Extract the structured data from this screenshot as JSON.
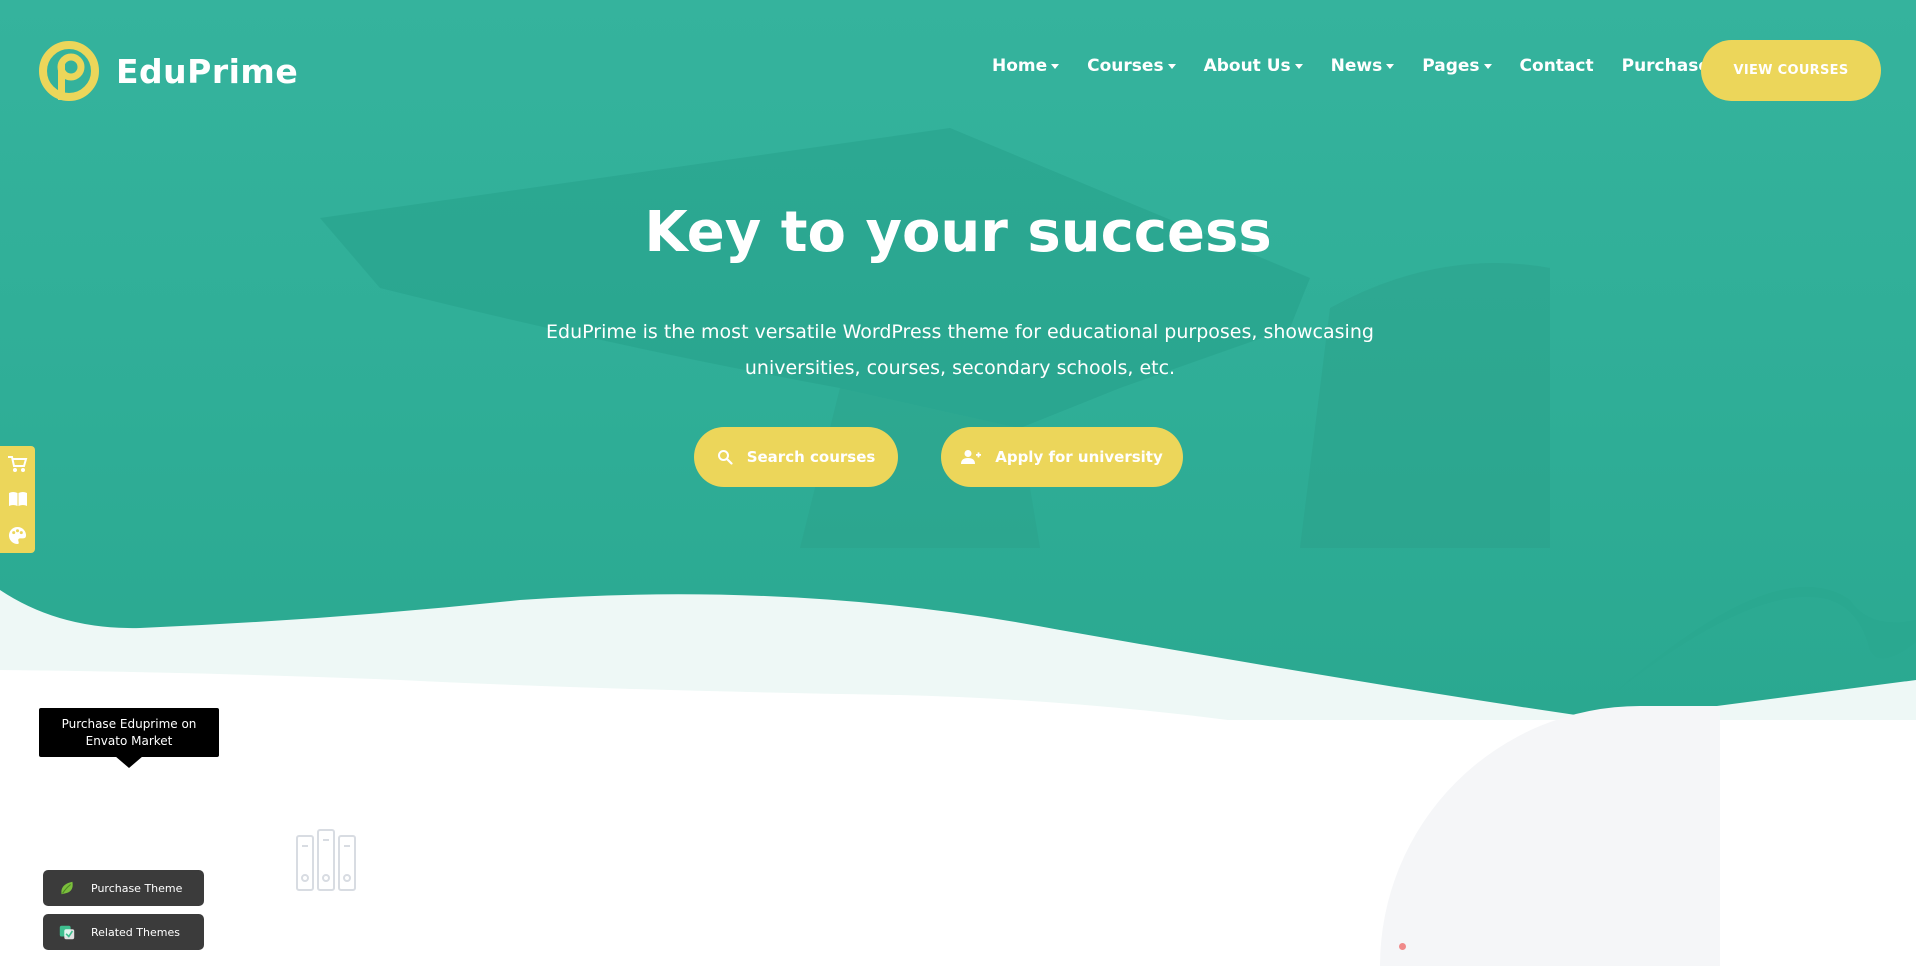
{
  "brand": {
    "name": "EduPrime",
    "color_primary": "#33b29c",
    "color_accent": "#ecd65a"
  },
  "nav": {
    "items": [
      {
        "label": "Home",
        "dropdown": true
      },
      {
        "label": "Courses",
        "dropdown": true
      },
      {
        "label": "About Us",
        "dropdown": true
      },
      {
        "label": "News",
        "dropdown": true
      },
      {
        "label": "Pages",
        "dropdown": true
      },
      {
        "label": "Contact",
        "dropdown": false
      },
      {
        "label": "Purchase",
        "dropdown": false
      }
    ],
    "cta_label": "VIEW COURSES"
  },
  "hero": {
    "title": "Key to your success",
    "subtitle": "EduPrime is the most versatile WordPress theme for educational purposes, showcasing universities, courses, secondary schools, etc.",
    "buttons": [
      {
        "label": "Search courses",
        "icon": "search-icon"
      },
      {
        "label": "Apply for university",
        "icon": "add-user-icon"
      }
    ]
  },
  "side_dock": {
    "icons": [
      "cart-icon",
      "book-icon",
      "palette-icon"
    ]
  },
  "tooltip": {
    "text": "Purchase Eduprime on Envato Market"
  },
  "floating": {
    "purchase_label": "Purchase Theme",
    "related_label": "Related Themes"
  }
}
